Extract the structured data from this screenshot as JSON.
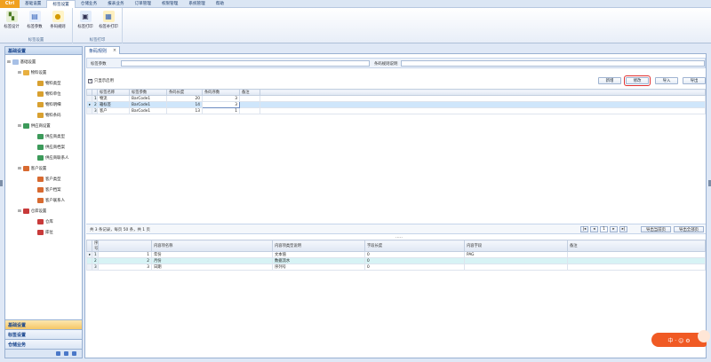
{
  "menubar": {
    "app_label": "Ctrl",
    "items": [
      "基础设置",
      "标签设置",
      "仓储业务",
      "报表业务",
      "订单管理",
      "权限管理",
      "系统管理",
      "帮助"
    ],
    "active_index": 1
  },
  "ribbon": {
    "groups": [
      {
        "label": "标签设置",
        "buttons": [
          "标签设计",
          "标签参数",
          "条码规则"
        ]
      },
      {
        "label": "标签打印",
        "buttons": [
          "标签打印",
          "标签补打印"
        ]
      }
    ]
  },
  "leftnav": {
    "title": "基础设置",
    "tree": {
      "root": "基础设置",
      "groups": [
        {
          "label": "物料设置",
          "children": [
            "物料类型",
            "物料单位",
            "物料明细",
            "物料条码"
          ]
        },
        {
          "label": "供应商设置",
          "children": [
            "供应商类型",
            "供应商档案",
            "供应商联系人"
          ]
        },
        {
          "label": "客户设置",
          "children": [
            "客户类型",
            "客户档案",
            "客户联系人"
          ]
        },
        {
          "label": "仓库设置",
          "children": [
            "仓库",
            "库位"
          ]
        }
      ]
    },
    "bottom_items": [
      "基础设置",
      "标签设置",
      "仓储业务"
    ],
    "active_bottom": 0
  },
  "tab": {
    "label": "条码规则"
  },
  "filter": {
    "label1": "标签参数",
    "value1": "",
    "label2": "条码规则说明",
    "value2": ""
  },
  "check": {
    "label": "只显示启用"
  },
  "actions": {
    "add": "新增",
    "edit": "修改",
    "import": "导入",
    "export": "导出"
  },
  "upper_grid": {
    "columns": [
      "标签名称",
      "标签参数",
      "条码长度",
      "条码序数",
      "备注"
    ],
    "rows": [
      {
        "ind": "1",
        "name": "物流",
        "param": "BarCode1",
        "len": "20",
        "seq": "3",
        "note": ""
      },
      {
        "ind": "2",
        "name": "箱标签",
        "param": "BarCode1",
        "len": "14",
        "seq": "3",
        "note": ""
      },
      {
        "ind": "3",
        "name": "客户",
        "param": "BarCode1",
        "len": "13",
        "seq": "1",
        "note": ""
      }
    ],
    "current_row": 1
  },
  "pager": {
    "text": "共 3 条记录，每页 50 条，共 1 页",
    "page": "1",
    "export_page": "导出当前页",
    "export_all": "导出全部页"
  },
  "lower_grid": {
    "columns": [
      "序号",
      "内容项名称",
      "内容项类型说明",
      "字段长度",
      "内容字段",
      "备注"
    ],
    "rows": [
      {
        "ind": "1",
        "seq": "1",
        "name": "年份",
        "type": "文本值",
        "len": "0",
        "field": "PAG",
        "note": ""
      },
      {
        "ind": "2",
        "seq": "2",
        "name": "月份",
        "type": "数据流水",
        "len": "0",
        "field": "",
        "note": ""
      },
      {
        "ind": "3",
        "seq": "3",
        "name": "日期",
        "type": "序列号",
        "len": "0",
        "field": "",
        "note": ""
      }
    ]
  },
  "badge": {
    "text": "中 · ☺ ⚙"
  },
  "colors": {
    "accent": "#15428b",
    "highlight": "#e03030",
    "app": "#f0a020"
  }
}
